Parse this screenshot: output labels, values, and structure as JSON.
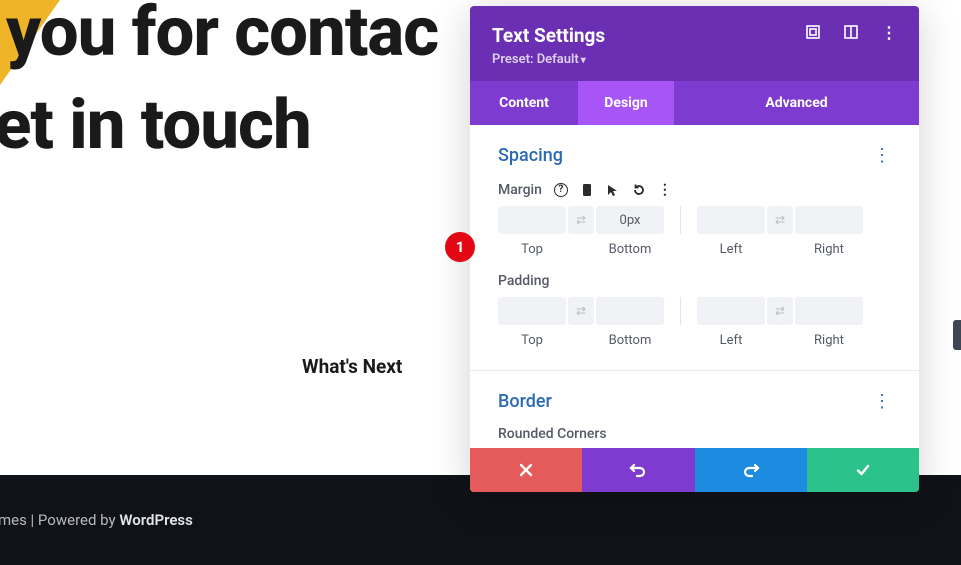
{
  "page": {
    "hero_line1": "Thank you for contac",
    "hero_line2": "We'll get in touch",
    "whats_next": "What's Next"
  },
  "footer": {
    "themes": "emes",
    "sep": " | ",
    "powered": "Powered by ",
    "wp": "WordPress"
  },
  "panel": {
    "title": "Text Settings",
    "preset_prefix": "Preset: ",
    "preset_value": "Default",
    "tabs": {
      "content": "Content",
      "design": "Design",
      "advanced": "Advanced"
    },
    "spacing": {
      "title": "Spacing",
      "margin_label": "Margin",
      "padding_label": "Padding",
      "bottom_value": "0px",
      "labels": {
        "top": "Top",
        "bottom": "Bottom",
        "left": "Left",
        "right": "Right"
      }
    },
    "border": {
      "title": "Border",
      "rounded": "Rounded Corners"
    }
  },
  "annotation": {
    "step": "1"
  }
}
